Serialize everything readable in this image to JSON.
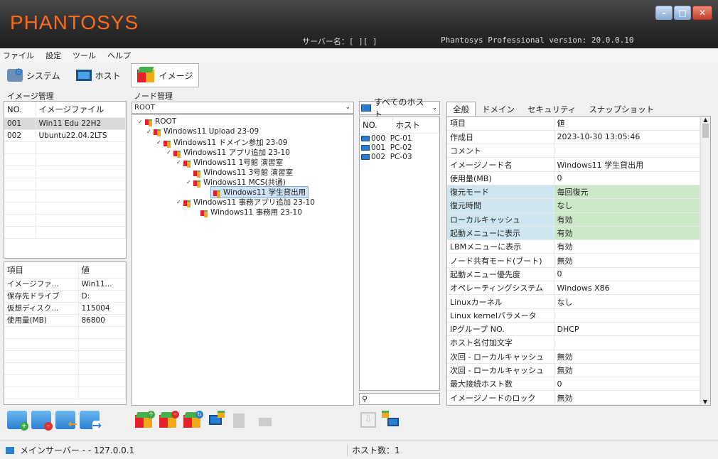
{
  "app": {
    "logo": "PHANTOSYS",
    "server_info": "サーバー名：[ ][   ]",
    "version": "Phantosys Professional version: 20.0.0.10"
  },
  "menu": [
    "ファイル",
    "設定",
    "ツール",
    "ヘルプ"
  ],
  "toolbar": [
    {
      "label": "システム",
      "icon": "system-icon"
    },
    {
      "label": "ホスト",
      "icon": "host-icon"
    },
    {
      "label": "イメージ",
      "icon": "image-cube-icon"
    }
  ],
  "image_mgmt": {
    "title": "イメージ管理",
    "columns": [
      "NO.",
      "イメージファイル"
    ],
    "rows": [
      {
        "no": "001",
        "name": "Win11 Edu 22H2"
      },
      {
        "no": "002",
        "name": "Ubuntu22.04.2LTS"
      }
    ],
    "detail_columns": [
      "項目",
      "値"
    ],
    "details": [
      {
        "k": "イメージファ...",
        "v": "Win11..."
      },
      {
        "k": "保存先ドライブ",
        "v": "D:"
      },
      {
        "k": "仮想ディスク...",
        "v": "115004"
      },
      {
        "k": "使用量(MB)",
        "v": "86800"
      }
    ]
  },
  "node_mgmt": {
    "title": "ノード管理",
    "root_select": "ROOT",
    "tree": [
      "ROOT",
      "Windows11 Upload 23-09",
      "Windows11 ドメイン参加 23-09",
      "Windows11 アプリ追加 23-10",
      "Windows11 1号館 演習室",
      "Windows11 3号館 演習室",
      "Windows11 MCS(共通)",
      "Windows11 学生貸出用",
      "Windows11 事務アプリ追加 23-10",
      "Windows11 事務用 23-10"
    ]
  },
  "hosts": {
    "select": "すべてのホスト",
    "columns": [
      "NO.",
      "ホスト"
    ],
    "rows": [
      {
        "no": "000",
        "host": "PC-01"
      },
      {
        "no": "001",
        "host": "PC-02"
      },
      {
        "no": "002",
        "host": "PC-03"
      }
    ],
    "search_placeholder": ""
  },
  "props": {
    "tabs": [
      "全般",
      "ドメイン",
      "セキュリティ",
      "スナップショット"
    ],
    "columns": [
      "項目",
      "値"
    ],
    "rows": [
      {
        "k": "作成日",
        "v": "2023-10-30 13:05:46"
      },
      {
        "k": "コメント",
        "v": ""
      },
      {
        "k": "イメージノード名",
        "v": "Windows11 学生貸出用"
      },
      {
        "k": "使用量(MB)",
        "v": "0"
      },
      {
        "k": "復元モード",
        "v": "毎回復元"
      },
      {
        "k": "復元時間",
        "v": "なし"
      },
      {
        "k": "ローカルキャッシュ",
        "v": "有効"
      },
      {
        "k": "起動メニューに表示",
        "v": "有効"
      },
      {
        "k": "LBMメニューに表示",
        "v": "有効"
      },
      {
        "k": "ノード共有モード(ブート)",
        "v": "無効"
      },
      {
        "k": "起動メニュー優先度",
        "v": "0"
      },
      {
        "k": "オペレーティングシステム",
        "v": "Windows X86"
      },
      {
        "k": "Linuxカーネル",
        "v": "なし"
      },
      {
        "k": "Linux kernelパラメータ",
        "v": ""
      },
      {
        "k": "IPグループ NO.",
        "v": "DHCP"
      },
      {
        "k": "ホスト名付加文字",
        "v": ""
      },
      {
        "k": "次回 - ローカルキャッシュ",
        "v": "無効"
      },
      {
        "k": "次回 - ローカルキャッシュ",
        "v": "無効"
      },
      {
        "k": "最大接続ホスト数",
        "v": "0"
      },
      {
        "k": "イメージノードのロック",
        "v": "無効"
      }
    ]
  },
  "status": {
    "server": "メインサーバー -  - 127.0.0.1",
    "host_count": "ホスト数：1"
  },
  "colors": {
    "accent": "#ff6a1a",
    "highlight_blue": "#cfe6f0",
    "highlight_green": "#cde8c8"
  }
}
